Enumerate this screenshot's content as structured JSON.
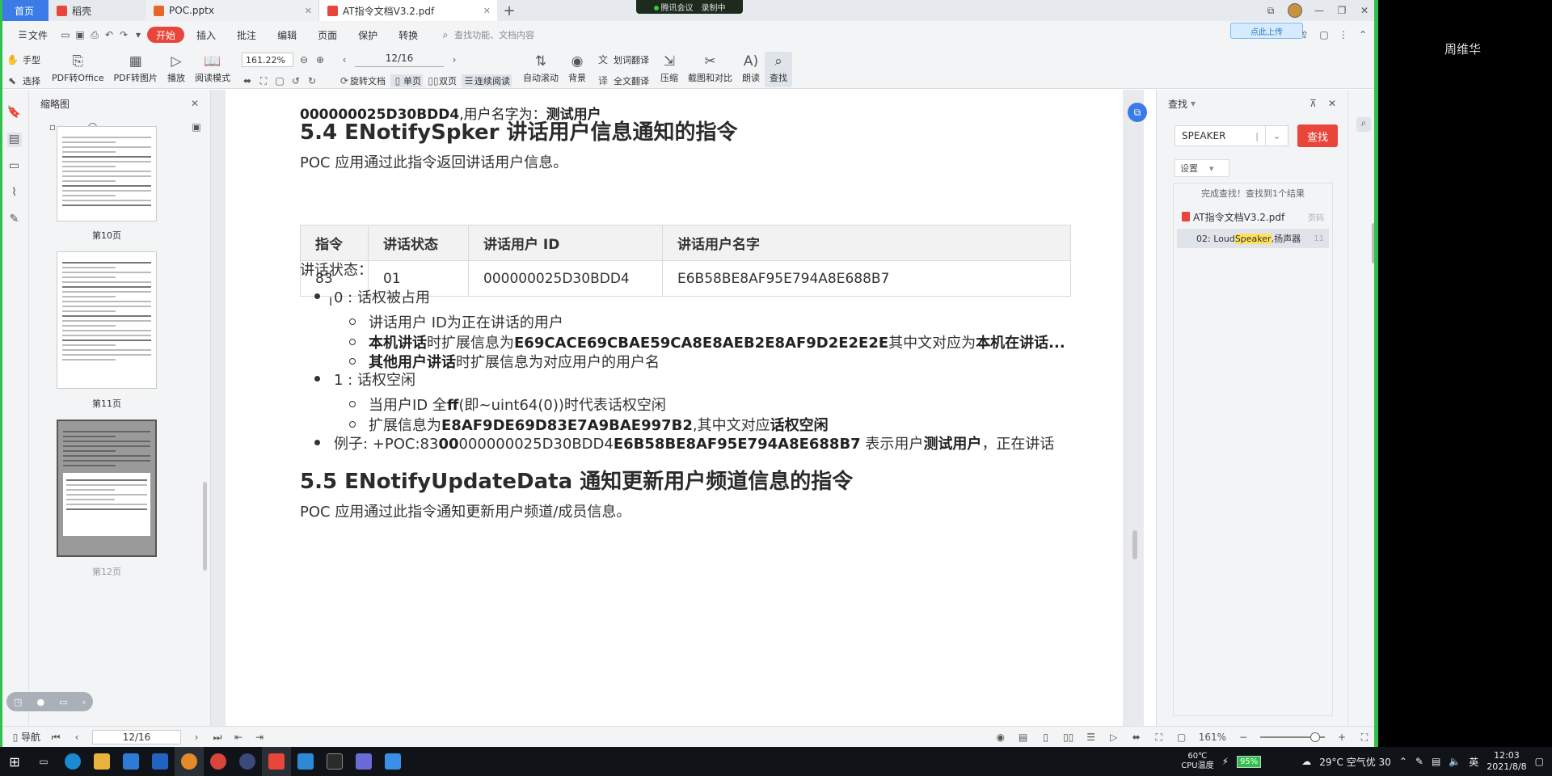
{
  "tabs": {
    "home": "首页",
    "doc": "稻壳",
    "pptx": "POC.pptx",
    "pdf": "AT指令文档V3.2.pdf",
    "plus": "+"
  },
  "meeting": {
    "label": "腾讯会议",
    "recording": "录制中"
  },
  "menubar": {
    "file": "文件",
    "items": [
      "开始",
      "插入",
      "批注",
      "编辑",
      "页面",
      "保护",
      "转换"
    ],
    "search_placeholder": "查找功能、文档内容",
    "upload_tooltip": "点此上传"
  },
  "toolbar": {
    "hand": "手型",
    "select": "选择",
    "pdf_to_office": "PDF转Office",
    "pdf_to_image": "PDF转图片",
    "play": "播放",
    "read_mode": "阅读模式",
    "zoom": "161.22%",
    "page": "12/16",
    "rotate": "旋转文档",
    "single": "单页",
    "double": "双页",
    "continuous": "连续阅读",
    "auto_scroll": "自动滚动",
    "background": "背景",
    "word_translate": "划词翻译",
    "full_translate": "全文翻译",
    "compress": "压缩",
    "screenshot": "截图和对比",
    "read_aloud": "朗读",
    "find": "查找"
  },
  "thumbnails": {
    "title": "缩略图",
    "labels": [
      "第10页",
      "第11页",
      "第12页"
    ]
  },
  "document": {
    "cut_line1": "例子：+POC:83000000025D30BDD4E6B58BE8AF95E794A8E688B7 表示用户测试用户，正在讲话",
    "cut_line2_prefix": "000000025D30BDD4",
    "cut_line2_mid": ",用户名字为：",
    "cut_line2_bold": "测试用户",
    "h_54": "5.4 ENotifySpker 讲话用户信息通知的指令",
    "p_54": "POC 应用通过此指令返回讲话用户信息。",
    "table": {
      "headers": [
        "指令",
        "讲话状态",
        "讲话用户 ID",
        "讲话用户名字"
      ],
      "rows": [
        [
          "83",
          "01",
          "000000025D30BDD4",
          "E6B58BE8AF95E794A8E688B7"
        ]
      ]
    },
    "status_label": "讲话状态：",
    "item0": "0 : 话权被占用",
    "item0_sub1": "讲话用户 ID为正在讲话的用户",
    "item0_sub2_b1": "本机讲话",
    "item0_sub2_t1": "时扩展信息为",
    "item0_sub2_b2": "E69CACE69CBAE59CA8E8AEB2E8AF9D2E2E2E",
    "item0_sub2_t2": "其中文对应为",
    "item0_sub2_b3": "本机在讲话...",
    "item0_sub3_b": "其他用户讲话",
    "item0_sub3_t": "时扩展信息为对应用户的用户名",
    "item1": "1 : 话权空闲",
    "item1_sub1_t1": "当用户ID 全",
    "item1_sub1_b": "ff",
    "item1_sub1_t2": "(即~uint64(0))时代表话权空闲",
    "item1_sub2_t1": "扩展信息为",
    "item1_sub2_b": "E8AF9DE69D83E7A9BAE997B2",
    "item1_sub2_t2": ",其中文对应",
    "item1_sub2_b2": "话权空闲",
    "example_t1": "例子: +POC:83",
    "example_b1": "00",
    "example_t2": "000000025D30BDD4",
    "example_b2": "E6B58BE8AF95E794A8E688B7",
    "example_t3": " 表示用户",
    "example_b3": "测试用户",
    "example_t4": "，正在讲话",
    "h_55": "5.5 ENotifyUpdateData 通知更新用户频道信息的指令",
    "p_55": "POC 应用通过此指令通知更新用户频道/成员信息。"
  },
  "find_panel": {
    "title": "查找",
    "query": "SPEAKER",
    "button": "查找",
    "settings": "设置",
    "status": "完成查找！查找到1个结果",
    "file": "AT指令文档V3.2.pdf",
    "file_page": "页码",
    "hit_prefix": "02: Loud ",
    "hit_match": "Speaker",
    "hit_suffix": ",扬声器",
    "hit_page": "11"
  },
  "statusbar": {
    "nav": "导航",
    "page": "12/16",
    "zoom": "161%"
  },
  "participant": "周维华",
  "taskbar": {
    "cpu_temp": "60℃",
    "cpu_label": "CPU温度",
    "battery": "95%",
    "weather": "29°C 空气优 30",
    "ime": "英",
    "time": "12:03",
    "date": "2021/8/8"
  }
}
